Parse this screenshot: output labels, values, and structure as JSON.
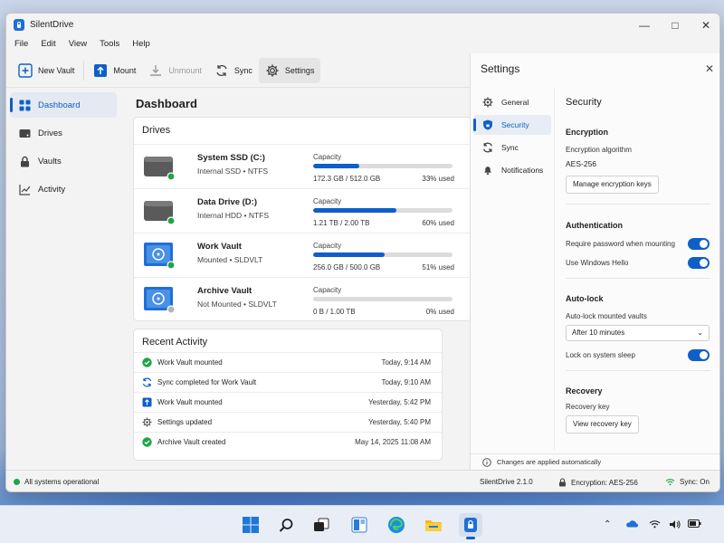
{
  "window": {
    "title": "SilentDrive"
  },
  "menu": [
    "File",
    "Edit",
    "View",
    "Tools",
    "Help"
  ],
  "toolbar": {
    "new_vault": "New Vault",
    "mount": "Mount",
    "unmount": "Unmount",
    "sync": "Sync",
    "settings": "Settings"
  },
  "sidebar": {
    "items": [
      {
        "label": "Dashboard",
        "icon": "grid-icon",
        "selected": true
      },
      {
        "label": "Drives",
        "icon": "drive-icon"
      },
      {
        "label": "Vaults",
        "icon": "lock-icon"
      },
      {
        "label": "Activity",
        "icon": "chart-icon"
      }
    ]
  },
  "dashboard": {
    "title": "Dashboard",
    "drives_title": "Drives",
    "capacity_label": "Capacity",
    "drives": [
      {
        "name": "System SSD (C:)",
        "sub": "Internal SSD • NTFS",
        "capacity": "172.3 GB / 512.0 GB",
        "percent": 33,
        "percent_text": "33% used",
        "type": "disk",
        "status": "green"
      },
      {
        "name": "Data Drive (D:)",
        "sub": "Internal HDD • NTFS",
        "capacity": "1.21 TB / 2.00 TB",
        "percent": 60,
        "percent_text": "60% used",
        "type": "disk",
        "status": "green"
      },
      {
        "name": "Work Vault",
        "sub": "Mounted • SLDVLT",
        "capacity": "256.0 GB / 500.0 GB",
        "percent": 51,
        "percent_text": "51% used",
        "type": "vault",
        "status": "green"
      },
      {
        "name": "Archive Vault",
        "sub": "Not Mounted • SLDVLT",
        "capacity": "0 B / 1.00 TB",
        "percent": 0,
        "percent_text": "0% used",
        "type": "vault",
        "status": "grey"
      }
    ],
    "activity_title": "Recent Activity",
    "activity": [
      {
        "text": "Work Vault mounted",
        "time": "Today, 9:14 AM",
        "icon": "check-circle-icon"
      },
      {
        "text": "Sync completed for Work Vault",
        "time": "Today, 9:10 AM",
        "icon": "sync-icon"
      },
      {
        "text": "Work Vault mounted",
        "time": "Yesterday, 5:42 PM",
        "icon": "mount-icon"
      },
      {
        "text": "Settings updated",
        "time": "Yesterday, 5:40 PM",
        "icon": "gear-icon"
      },
      {
        "text": "Archive Vault created",
        "time": "May 14, 2025   11:08 AM",
        "icon": "check-circle-icon"
      }
    ]
  },
  "settings": {
    "title": "Settings",
    "nav": [
      {
        "label": "General",
        "icon": "gear-icon"
      },
      {
        "label": "Security",
        "icon": "shield-icon",
        "selected": true
      },
      {
        "label": "Sync",
        "icon": "sync-icon"
      },
      {
        "label": "Notifications",
        "icon": "bell-icon"
      }
    ],
    "section_title": "Security",
    "encryption": {
      "heading": "Encryption",
      "algorithm_label": "Encryption algorithm",
      "algorithm_value": "AES-256",
      "manage_button": "Manage encryption keys"
    },
    "authentication": {
      "heading": "Authentication",
      "require_password": "Require password when mounting",
      "windows_hello": "Use Windows Hello"
    },
    "autolock": {
      "heading": "Auto-lock",
      "mounted_label": "Auto-lock mounted vaults",
      "mounted_value": "After 10 minutes",
      "sleep_label": "Lock on system sleep"
    },
    "recovery": {
      "heading": "Recovery",
      "key_label": "Recovery key",
      "view_button": "View recovery key"
    },
    "footer": "Changes are applied automatically"
  },
  "statusbar": {
    "status": "All systems operational",
    "version": "SilentDrive 2.1.0",
    "encryption": "Encryption: AES-256",
    "sync": "Sync: On"
  },
  "colors": {
    "accent": "#0f5fc8",
    "ok": "#1ea446"
  }
}
